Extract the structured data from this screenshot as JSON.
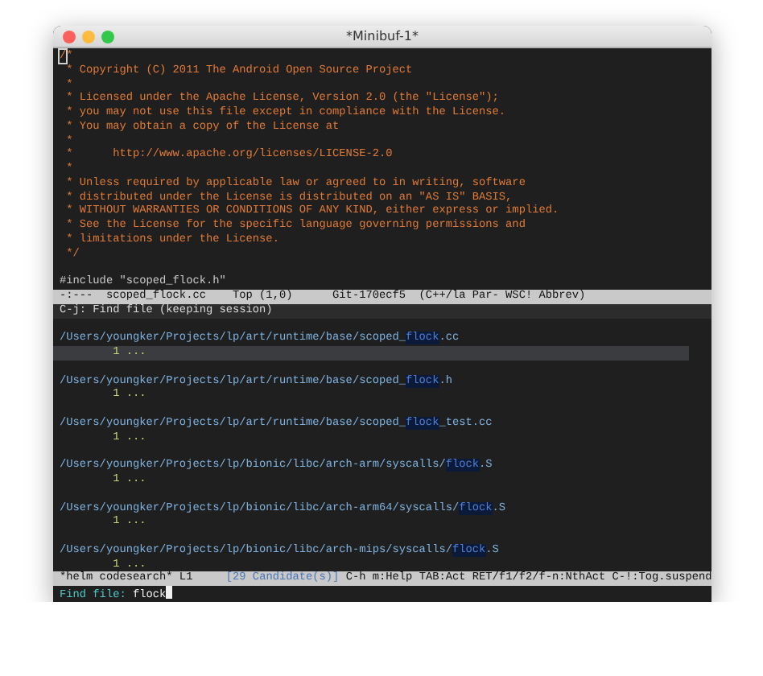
{
  "window": {
    "title": "*Minibuf-1*"
  },
  "editor": {
    "point_on_first_line": true,
    "lines": [
      {
        "kind": "comment",
        "text": "/*"
      },
      {
        "kind": "comment",
        "text": " * Copyright (C) 2011 The Android Open Source Project"
      },
      {
        "kind": "comment",
        "text": " *"
      },
      {
        "kind": "comment",
        "text": " * Licensed under the Apache License, Version 2.0 (the \"License\");"
      },
      {
        "kind": "comment",
        "text": " * you may not use this file except in compliance with the License."
      },
      {
        "kind": "comment",
        "text": " * You may obtain a copy of the License at"
      },
      {
        "kind": "comment",
        "text": " *"
      },
      {
        "kind": "comment",
        "text": " *      http://www.apache.org/licenses/LICENSE-2.0"
      },
      {
        "kind": "comment",
        "text": " *"
      },
      {
        "kind": "comment",
        "text": " * Unless required by applicable law or agreed to in writing, software"
      },
      {
        "kind": "comment",
        "text": " * distributed under the License is distributed on an \"AS IS\" BASIS,"
      },
      {
        "kind": "comment",
        "text": " * WITHOUT WARRANTIES OR CONDITIONS OF ANY KIND, either express or implied."
      },
      {
        "kind": "comment",
        "text": " * See the License for the specific language governing permissions and"
      },
      {
        "kind": "comment",
        "text": " * limitations under the License."
      },
      {
        "kind": "comment",
        "text": " */"
      },
      {
        "kind": "blank"
      },
      {
        "kind": "code",
        "text": "#include \"scoped_flock.h\""
      }
    ]
  },
  "mode_line": "-:---  scoped_flock.cc    Top (1,0)      Git-170ecf5  (C++/la Par- WSC! Abbrev)",
  "helm": {
    "header": "C-j: Find file (keeping session)",
    "candidates": [
      {
        "before": "/Users/youngker/Projects/lp/art/runtime/base/scoped_",
        "match": "flock",
        "after": ".cc",
        "detail": "1 ...",
        "selected": true
      },
      {
        "before": "/Users/youngker/Projects/lp/art/runtime/base/scoped_",
        "match": "flock",
        "after": ".h",
        "detail": "1 ...",
        "selected": false
      },
      {
        "before": "/Users/youngker/Projects/lp/art/runtime/base/scoped_",
        "match": "flock",
        "after": "_test.cc",
        "detail": "1 ...",
        "selected": false
      },
      {
        "before": "/Users/youngker/Projects/lp/bionic/libc/arch-arm/syscalls/",
        "match": "flock",
        "after": ".S",
        "detail": "1 ...",
        "selected": false
      },
      {
        "before": "/Users/youngker/Projects/lp/bionic/libc/arch-arm64/syscalls/",
        "match": "flock",
        "after": ".S",
        "detail": "1 ...",
        "selected": false
      },
      {
        "before": "/Users/youngker/Projects/lp/bionic/libc/arch-mips/syscalls/",
        "match": "flock",
        "after": ".S",
        "detail": "1 ...",
        "selected": false
      }
    ],
    "mode_line": {
      "buffer": "*helm codesearch* L1",
      "count": "[29 Candidate(s)]",
      "keys": "C-h m:Help TAB:Act RET/f1/f2/f-n:NthAct C-!:Tog.suspend"
    }
  },
  "minibuffer": {
    "prompt": "Find file:",
    "input": "flock"
  }
}
